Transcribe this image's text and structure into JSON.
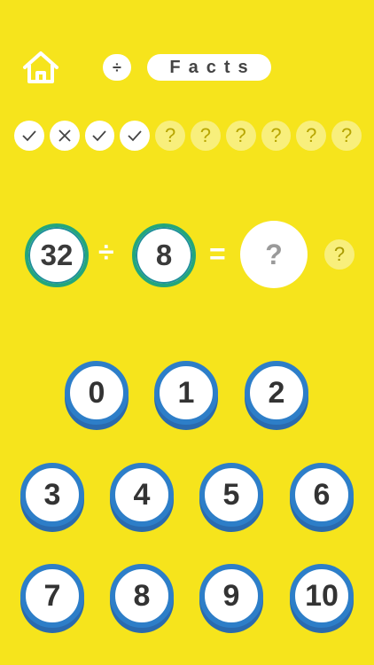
{
  "header": {
    "home_icon": "home-icon",
    "operation_symbol": "÷",
    "title": "Facts"
  },
  "progress": [
    {
      "state": "correct",
      "icon": "check-icon"
    },
    {
      "state": "wrong",
      "icon": "cross-icon"
    },
    {
      "state": "correct",
      "icon": "check-icon"
    },
    {
      "state": "correct",
      "icon": "check-icon"
    },
    {
      "state": "pending",
      "label": "?"
    },
    {
      "state": "pending",
      "label": "?"
    },
    {
      "state": "pending",
      "label": "?"
    },
    {
      "state": "pending",
      "label": "?"
    },
    {
      "state": "pending",
      "label": "?"
    },
    {
      "state": "pending",
      "label": "?"
    }
  ],
  "question": {
    "operand_a": "32",
    "operator": "÷",
    "operand_b": "8",
    "equals": "=",
    "answer_placeholder": "?",
    "hint_label": "?"
  },
  "keypad": {
    "keys": [
      "0",
      "1",
      "2",
      "3",
      "4",
      "5",
      "6",
      "7",
      "8",
      "9",
      "10"
    ]
  },
  "colors": {
    "background": "#f6e41c",
    "operand_ring": "#23a67b",
    "key_ring": "#2d7ec8"
  }
}
